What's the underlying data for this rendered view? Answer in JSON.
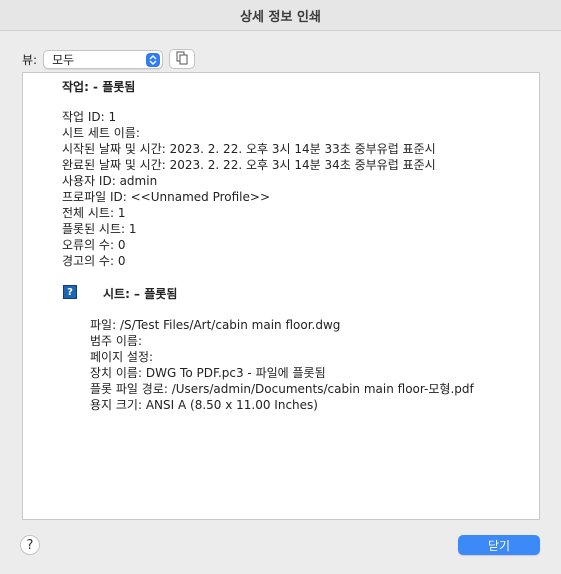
{
  "window": {
    "title": "상세 정보 인쇄"
  },
  "view": {
    "label": "뷰:",
    "selected": "모두"
  },
  "job": {
    "title": "작업: - 플롯됨",
    "lines": [
      "작업 ID: 1",
      "시트 세트 이름:",
      "시작된 날짜 및 시간: 2023. 2. 22. 오후 3시 14분 33초 중부유럽 표준시",
      "완료된 날짜 및 시간: 2023. 2. 22. 오후 3시 14분 34초 중부유럽 표준시",
      "사용자 ID: admin",
      "프로파일 ID: <<Unnamed Profile>>",
      "전체 시트: 1",
      "플롯된 시트: 1",
      "오류의 수: 0",
      "경고의 수: 0"
    ]
  },
  "sheet": {
    "icon_glyph": "?",
    "title": "시트: – 플롯됨",
    "lines": [
      "파일: /S/Test Files/Art/cabin main floor.dwg",
      "범주 이름:",
      "페이지 설정:",
      "장치 이름: DWG To PDF.pc3 - 파일에 플롯됨",
      "플롯 파일 경로: /Users/admin/Documents/cabin main floor-모형.pdf",
      "용지 크기: ANSI A (8.50 x 11.00 Inches)"
    ]
  },
  "footer": {
    "help_glyph": "?",
    "close_label": "닫기"
  },
  "colors": {
    "accent": "#3b8af7",
    "stepper": "#2f7cf6",
    "sheet_icon": "#1d66b5"
  }
}
